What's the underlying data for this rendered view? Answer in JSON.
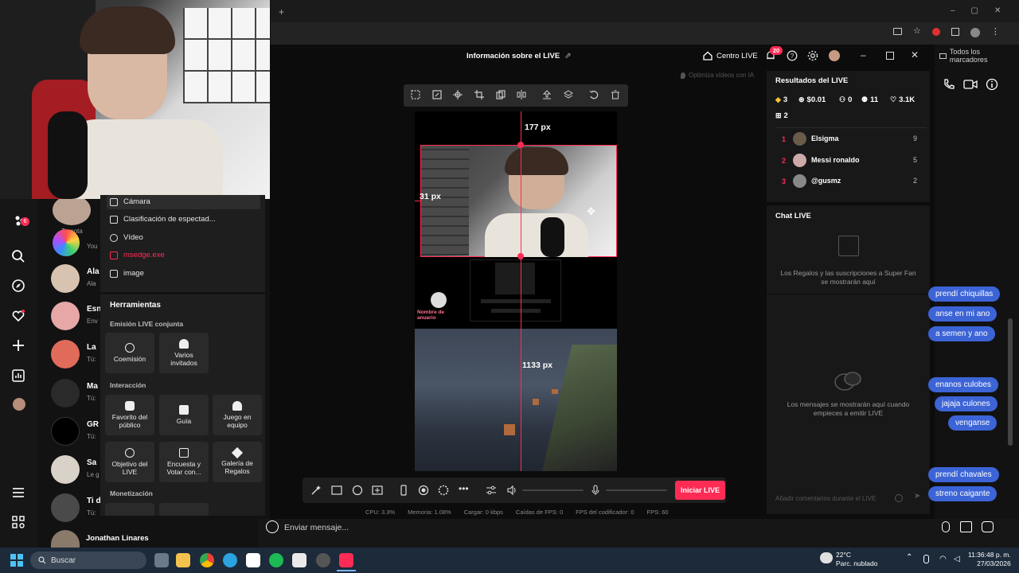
{
  "browser": {
    "bookmarks_label": "Todos los marcadores"
  },
  "studio": {
    "title": "Información sobre el LIVE",
    "centro_live": "Centro LIVE",
    "notif_count": "20",
    "optimiza": "Optimiza vídeos con IA",
    "measure_top": "177 px",
    "measure_left": "31 px",
    "measure_game": "1133 px",
    "avatar_name": "Nombre de anuario",
    "start_button": "Iniciar LIVE",
    "stats": {
      "cpu": "CPU: 3.3%",
      "memoria": "Memoria: 1.08%",
      "cargar": "Cargar: 0 kbps",
      "caidas": "Caídas de FPS: 0",
      "fps_cod": "FPS del codificador: 0",
      "fps": "FPS: 60"
    }
  },
  "sources": {
    "camara": "Cámara",
    "clasificacion": "Clasificación de espectad...",
    "video": "Vídeo",
    "msedge": "msedge.exe",
    "image": "image"
  },
  "tools": {
    "heading": "Herramientas",
    "section_joint": "Emisión LIVE conjunta",
    "section_interaction": "Interacción",
    "section_monetization": "Monetización",
    "coemision": "Coemisión",
    "varios": "Varios invitados",
    "favorito": "Favorito del público",
    "guia": "Guía",
    "juego": "Juego en equipo",
    "objetivo": "Objetivo del LIVE",
    "encuesta": "Encuesta y Votar con...",
    "galeria": "Galería de Regalos"
  },
  "results": {
    "title": "Resultados del LIVE",
    "diamonds": "3",
    "money": "$0.01",
    "viewers": "0",
    "followers": "11",
    "likes": "3.1K",
    "gifts": "2",
    "ranking": [
      {
        "rank": "1",
        "name": "Elsigma",
        "score": "9"
      },
      {
        "rank": "2",
        "name": "Messi ronaldo",
        "score": "5"
      },
      {
        "rank": "3",
        "name": "@gusmz",
        "score": "2"
      }
    ]
  },
  "chat": {
    "title": "Chat LIVE",
    "gifts_note": "Los Regalos y las suscripciones a Super Fan se mostrarán aquí",
    "messages_note": "Los mensajes se mostrarán aquí cuando empieces a emitir LIVE",
    "input_placeholder": "Añadir comentarios durante el LIVE"
  },
  "dm": {
    "bubbles": [
      "prendí chiquillas",
      "anse en mi ano",
      "a semen y ano",
      "enanos culobes",
      "jajaja culones",
      "venganse",
      "prendí chavales",
      "streno caigante"
    ],
    "message_placeholder": "Enviar mensaje...",
    "last_contact": "Jonathan Linares"
  },
  "tiktok": {
    "tu_nota": "Tu nota",
    "badge": "6",
    "contacts": [
      {
        "name": "Ala",
        "sub": "Ala"
      },
      {
        "name": "Esn",
        "sub": "Env"
      },
      {
        "name": "La",
        "sub": "Tú:"
      },
      {
        "name": "Ma",
        "sub": "Tú:"
      },
      {
        "name": "GR",
        "sub": "Tú:"
      },
      {
        "name": "Sa",
        "sub": "Le g"
      },
      {
        "name": "Ti d",
        "sub": "Tú:"
      }
    ],
    "you_label": "You"
  },
  "taskbar": {
    "search": "Buscar",
    "temp": "22°C",
    "weather": "Parc. nublado",
    "time": "11:36:48 p. m.",
    "date": "27/03/2026"
  },
  "colors": {
    "accent": "#fe2c55",
    "bubble": "#3c64d6"
  }
}
